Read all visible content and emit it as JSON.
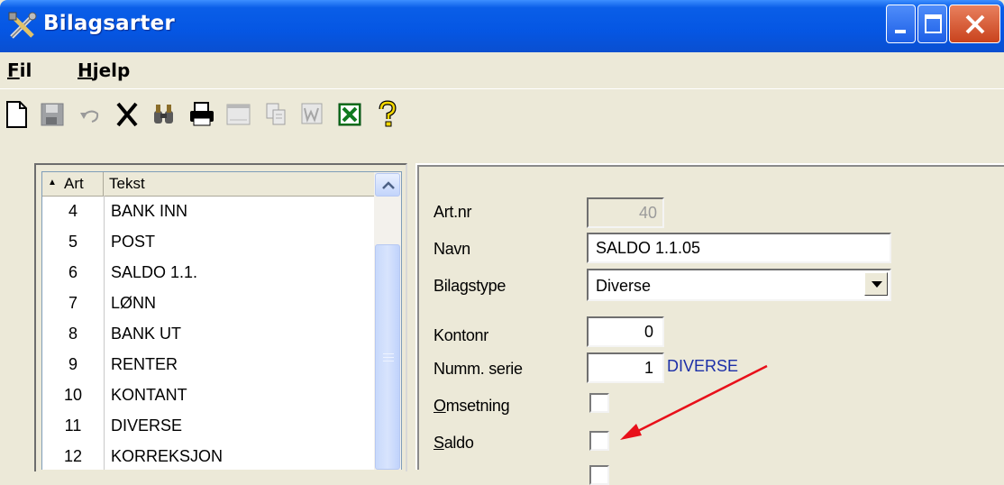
{
  "window": {
    "title": "Bilagsarter"
  },
  "menu": {
    "fil": {
      "accel": "F",
      "rest": "il"
    },
    "hjelp": {
      "accel": "H",
      "rest": "jelp"
    }
  },
  "toolbar": {
    "buttons": [
      "new-icon",
      "save-icon",
      "undo-icon",
      "delete-icon",
      "find-icon",
      "print-icon",
      "preview-icon",
      "copy-icon",
      "word-icon",
      "excel-icon",
      "help-icon"
    ]
  },
  "list": {
    "columns": {
      "art": "Art",
      "tekst": "Tekst"
    },
    "sort_indicator": "▲",
    "rows": [
      {
        "art": "4",
        "tekst": "BANK INN"
      },
      {
        "art": "5",
        "tekst": "POST"
      },
      {
        "art": "6",
        "tekst": "SALDO 1.1."
      },
      {
        "art": "7",
        "tekst": "LØNN"
      },
      {
        "art": "8",
        "tekst": "BANK UT"
      },
      {
        "art": "9",
        "tekst": "RENTER"
      },
      {
        "art": "10",
        "tekst": "KONTANT"
      },
      {
        "art": "11",
        "tekst": "DIVERSE"
      },
      {
        "art": "12",
        "tekst": "KORREKSJON"
      }
    ]
  },
  "form": {
    "artnr": {
      "label": "Art.nr",
      "value": "40"
    },
    "navn": {
      "label": "Navn",
      "value": "SALDO  1.1.05"
    },
    "bilagstype": {
      "label": "Bilagstype",
      "value": "Diverse"
    },
    "kontonr": {
      "label": "Kontonr",
      "value": "0"
    },
    "numm_serie": {
      "label": "Numm. serie",
      "value": "1",
      "name": "DIVERSE"
    },
    "omsetning": {
      "accel": "O",
      "rest": "msetning",
      "checked": false
    },
    "saldo": {
      "accel": "S",
      "rest": "aldo",
      "checked": false
    }
  },
  "colors": {
    "titlebar": "#0556e3",
    "arrow": "#e8101a",
    "serie_text": "#1c2fa8"
  }
}
